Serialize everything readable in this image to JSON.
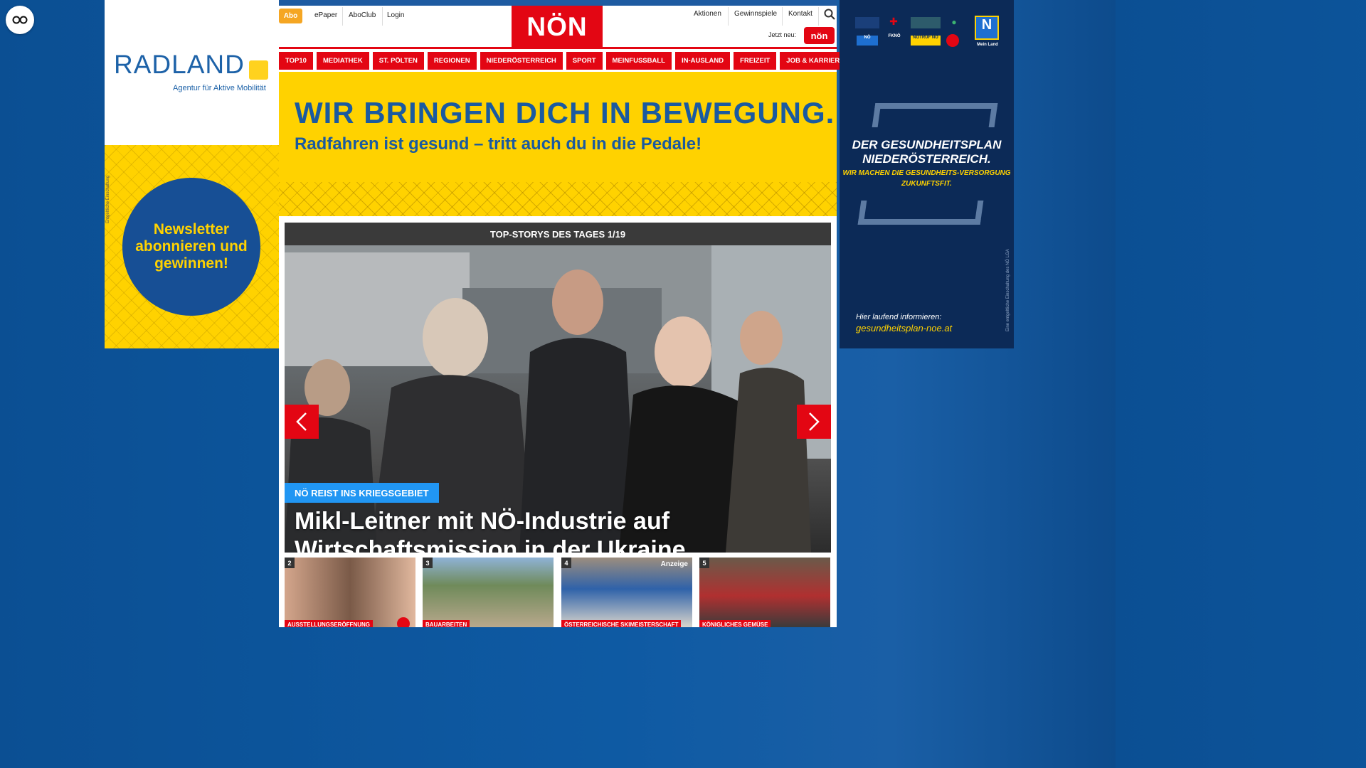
{
  "reader": {
    "icon": "glasses-icon"
  },
  "left_ad": {
    "logo_word": "RADLAND",
    "logo_sub": "Agentur für Aktive Mobilität",
    "newsletter": "Newsletter abonnieren und gewinnen!",
    "note": "Entgeltliche Einschaltung"
  },
  "header": {
    "abo": "Abo",
    "links": [
      "ePaper",
      "AboClub",
      "Login"
    ],
    "brand": "NÖN",
    "right_links": [
      "Aktionen",
      "Gewinnspiele",
      "Kontakt"
    ],
    "jetzt_neu": "Jetzt neu:",
    "badge": "nön"
  },
  "nav": [
    "TOP10",
    "MEDIATHEK",
    "ST. PÖLTEN",
    "REGIONEN",
    "NIEDERÖSTERREICH",
    "SPORT",
    "MEINFUSSBALL",
    "IN-AUSLAND",
    "FREIZEIT",
    "JOB & KARRIERE"
  ],
  "banner": {
    "headline": "WIR BRINGEN DICH IN BEWEGUNG.",
    "subline": "Radfahren ist gesund – tritt auch du in die Pedale!"
  },
  "slider": {
    "heading": "TOP-STORYS DES TAGES 1/19",
    "tag": "NÖ REIST INS KRIEGSGEBIET",
    "title": "Mikl-Leitner mit NÖ-Industrie auf Wirtschaftsmission in der Ukraine"
  },
  "thumbs": [
    {
      "num": "2",
      "caption": "AUSSTELLUNGSERÖFFNUNG",
      "anzeige": ""
    },
    {
      "num": "3",
      "caption": "BAUARBEITEN",
      "anzeige": ""
    },
    {
      "num": "4",
      "caption": "ÖSTERREICHISCHE SKIMEISTERSCHAFT",
      "anzeige": "Anzeige"
    },
    {
      "num": "5",
      "caption": "KÖNIGLICHES GEMÜSE",
      "anzeige": ""
    }
  ],
  "right_ad": {
    "title": "DER GESUNDHEITSPLAN NIEDERÖSTERREICH.",
    "sub": "WIR MACHEN DIE GESUNDHEITS-VERSORGUNG ZUKUNFTSFIT.",
    "info": "Hier laufend informieren:",
    "link": "gesundheitsplan-noe.at",
    "note": "Eine entgeltliche Einschaltung des NÖ LGA",
    "logos": [
      "NÖ",
      "FKNÖ",
      "NOTRUF NÖ",
      "GGK",
      "Mein Land"
    ]
  },
  "colors": {
    "brand_red": "#e30613",
    "ad_yellow": "#ffd200",
    "ad_blue": "#1a5aa0",
    "tag_blue": "#2196f3"
  }
}
